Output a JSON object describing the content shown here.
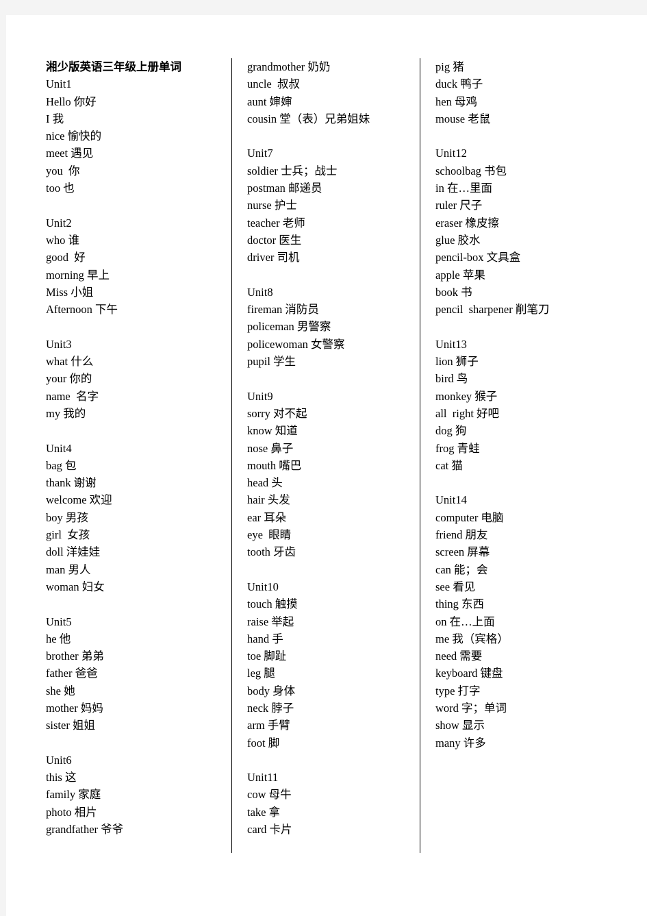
{
  "document": {
    "title": "湘少版英语三年级上册单词"
  },
  "columns": [
    {
      "id": "column-1",
      "blocks": [
        {
          "type": "title",
          "text": "湘少版英语三年级上册单词"
        },
        {
          "type": "unit",
          "text": "Unit1"
        },
        {
          "type": "entry",
          "text": "Hello 你好"
        },
        {
          "type": "entry",
          "text": "I 我"
        },
        {
          "type": "entry",
          "text": "nice 愉快的"
        },
        {
          "type": "entry",
          "text": "meet 遇见"
        },
        {
          "type": "entry",
          "text": "you  你"
        },
        {
          "type": "entry",
          "text": "too 也"
        },
        {
          "type": "blank",
          "text": ""
        },
        {
          "type": "unit",
          "text": "Unit2"
        },
        {
          "type": "entry",
          "text": "who 谁"
        },
        {
          "type": "entry",
          "text": "good  好"
        },
        {
          "type": "entry",
          "text": "morning 早上"
        },
        {
          "type": "entry",
          "text": "Miss 小姐"
        },
        {
          "type": "entry",
          "text": "Afternoon 下午"
        },
        {
          "type": "blank",
          "text": ""
        },
        {
          "type": "unit",
          "text": "Unit3"
        },
        {
          "type": "entry",
          "text": "what 什么"
        },
        {
          "type": "entry",
          "text": "your 你的"
        },
        {
          "type": "entry",
          "text": "name  名字"
        },
        {
          "type": "entry",
          "text": "my 我的"
        },
        {
          "type": "blank",
          "text": ""
        },
        {
          "type": "unit",
          "text": "Unit4"
        },
        {
          "type": "entry",
          "text": "bag 包"
        },
        {
          "type": "entry",
          "text": "thank 谢谢"
        },
        {
          "type": "entry",
          "text": "welcome 欢迎"
        },
        {
          "type": "entry",
          "text": "boy 男孩"
        },
        {
          "type": "entry",
          "text": "girl  女孩"
        },
        {
          "type": "entry",
          "text": "doll 洋娃娃"
        },
        {
          "type": "entry",
          "text": "man 男人"
        },
        {
          "type": "entry",
          "text": "woman 妇女"
        },
        {
          "type": "blank",
          "text": ""
        },
        {
          "type": "unit",
          "text": "Unit5"
        },
        {
          "type": "entry",
          "text": "he 他"
        },
        {
          "type": "entry",
          "text": "brother 弟弟"
        },
        {
          "type": "entry",
          "text": "father 爸爸"
        },
        {
          "type": "entry",
          "text": "she 她"
        },
        {
          "type": "entry",
          "text": "mother 妈妈"
        },
        {
          "type": "entry",
          "text": "sister 姐姐"
        },
        {
          "type": "blank",
          "text": ""
        },
        {
          "type": "unit",
          "text": "Unit6"
        },
        {
          "type": "entry",
          "text": "this 这"
        },
        {
          "type": "entry",
          "text": "family 家庭"
        },
        {
          "type": "entry",
          "text": "photo 相片"
        },
        {
          "type": "entry",
          "text": "grandfather 爷爷"
        }
      ]
    },
    {
      "id": "column-2",
      "blocks": [
        {
          "type": "entry",
          "text": "grandmother 奶奶"
        },
        {
          "type": "entry",
          "text": "uncle  叔叔"
        },
        {
          "type": "entry",
          "text": "aunt 婶婶"
        },
        {
          "type": "entry",
          "text": "cousin 堂（表）兄弟姐妹"
        },
        {
          "type": "blank",
          "text": ""
        },
        {
          "type": "unit",
          "text": "Unit7"
        },
        {
          "type": "entry",
          "text": "soldier 士兵；战士"
        },
        {
          "type": "entry",
          "text": "postman 邮递员"
        },
        {
          "type": "entry",
          "text": "nurse 护士"
        },
        {
          "type": "entry",
          "text": "teacher 老师"
        },
        {
          "type": "entry",
          "text": "doctor 医生"
        },
        {
          "type": "entry",
          "text": "driver 司机"
        },
        {
          "type": "blank",
          "text": ""
        },
        {
          "type": "unit",
          "text": "Unit8"
        },
        {
          "type": "entry",
          "text": "fireman 消防员"
        },
        {
          "type": "entry",
          "text": "policeman 男警察"
        },
        {
          "type": "entry",
          "text": "policewoman 女警察"
        },
        {
          "type": "entry",
          "text": "pupil 学生"
        },
        {
          "type": "blank",
          "text": ""
        },
        {
          "type": "unit",
          "text": "Unit9"
        },
        {
          "type": "entry",
          "text": "sorry 对不起"
        },
        {
          "type": "entry",
          "text": "know 知道"
        },
        {
          "type": "entry",
          "text": "nose 鼻子"
        },
        {
          "type": "entry",
          "text": "mouth 嘴巴"
        },
        {
          "type": "entry",
          "text": "head 头"
        },
        {
          "type": "entry",
          "text": "hair 头发"
        },
        {
          "type": "entry",
          "text": "ear 耳朵"
        },
        {
          "type": "entry",
          "text": "eye  眼睛"
        },
        {
          "type": "entry",
          "text": "tooth 牙齿"
        },
        {
          "type": "blank",
          "text": ""
        },
        {
          "type": "unit",
          "text": "Unit10"
        },
        {
          "type": "entry",
          "text": "touch 触摸"
        },
        {
          "type": "entry",
          "text": "raise 举起"
        },
        {
          "type": "entry",
          "text": "hand 手"
        },
        {
          "type": "entry",
          "text": "toe 脚趾"
        },
        {
          "type": "entry",
          "text": "leg 腿"
        },
        {
          "type": "entry",
          "text": "body 身体"
        },
        {
          "type": "entry",
          "text": "neck 脖子"
        },
        {
          "type": "entry",
          "text": "arm 手臂"
        },
        {
          "type": "entry",
          "text": "foot 脚"
        },
        {
          "type": "blank",
          "text": ""
        },
        {
          "type": "unit",
          "text": "Unit11"
        },
        {
          "type": "entry",
          "text": "cow 母牛"
        },
        {
          "type": "entry",
          "text": "take 拿"
        },
        {
          "type": "entry",
          "text": "card 卡片"
        }
      ]
    },
    {
      "id": "column-3",
      "blocks": [
        {
          "type": "entry",
          "text": "pig 猪"
        },
        {
          "type": "entry",
          "text": "duck 鸭子"
        },
        {
          "type": "entry",
          "text": "hen 母鸡"
        },
        {
          "type": "entry",
          "text": "mouse 老鼠"
        },
        {
          "type": "blank",
          "text": ""
        },
        {
          "type": "unit",
          "text": "Unit12"
        },
        {
          "type": "entry",
          "text": "schoolbag 书包"
        },
        {
          "type": "entry",
          "text": "in 在…里面"
        },
        {
          "type": "entry",
          "text": "ruler 尺子"
        },
        {
          "type": "entry",
          "text": "eraser 橡皮擦"
        },
        {
          "type": "entry",
          "text": "glue 胶水"
        },
        {
          "type": "entry",
          "text": "pencil-box 文具盒"
        },
        {
          "type": "entry",
          "text": "apple 苹果"
        },
        {
          "type": "entry",
          "text": "book 书"
        },
        {
          "type": "entry",
          "text": "pencil  sharpener 削笔刀"
        },
        {
          "type": "blank",
          "text": ""
        },
        {
          "type": "unit",
          "text": "Unit13"
        },
        {
          "type": "entry",
          "text": "lion 狮子"
        },
        {
          "type": "entry",
          "text": "bird 鸟"
        },
        {
          "type": "entry",
          "text": "monkey 猴子"
        },
        {
          "type": "entry",
          "text": "all  right 好吧"
        },
        {
          "type": "entry",
          "text": "dog 狗"
        },
        {
          "type": "entry",
          "text": "frog 青蛙"
        },
        {
          "type": "entry",
          "text": "cat 猫"
        },
        {
          "type": "blank",
          "text": ""
        },
        {
          "type": "unit",
          "text": "Unit14"
        },
        {
          "type": "entry",
          "text": "computer 电脑"
        },
        {
          "type": "entry",
          "text": "friend 朋友"
        },
        {
          "type": "entry",
          "text": "screen 屏幕"
        },
        {
          "type": "entry",
          "text": "can 能；会"
        },
        {
          "type": "entry",
          "text": "see 看见"
        },
        {
          "type": "entry",
          "text": "thing 东西"
        },
        {
          "type": "entry",
          "text": "on 在…上面"
        },
        {
          "type": "entry",
          "text": "me 我（宾格）"
        },
        {
          "type": "entry",
          "text": "need 需要"
        },
        {
          "type": "entry",
          "text": "keyboard 键盘"
        },
        {
          "type": "entry",
          "text": "type 打字"
        },
        {
          "type": "entry",
          "text": "word 字；单词"
        },
        {
          "type": "entry",
          "text": "show 显示"
        },
        {
          "type": "entry",
          "text": "many 许多"
        }
      ]
    }
  ]
}
